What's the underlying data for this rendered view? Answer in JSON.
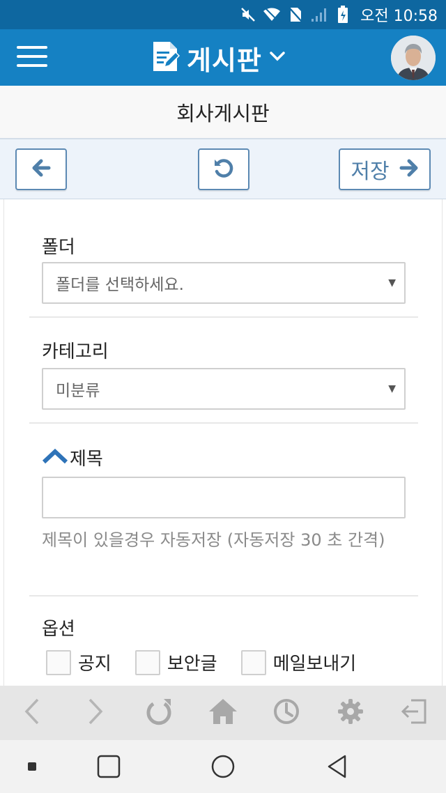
{
  "status_bar": {
    "carrier_time": "오전 10:58",
    "icons": [
      "mute-icon",
      "wifi-icon",
      "no-sim-icon",
      "signal-icon",
      "battery-icon"
    ]
  },
  "app_bar": {
    "title": "게시판",
    "icons": {
      "menu": "hamburger-menu-icon",
      "board": "board-document-icon",
      "dropdown": "chevron-down-icon",
      "avatar": "user-avatar"
    }
  },
  "sub_header": {
    "board_name": "회사게시판"
  },
  "toolbar": {
    "back_icon": "arrow-left-icon",
    "refresh_icon": "refresh-icon",
    "save_label": "저장",
    "save_icon": "arrow-right-icon"
  },
  "form": {
    "folder": {
      "label": "폴더",
      "selected": "폴더를 선택하세요."
    },
    "category": {
      "label": "카테고리",
      "selected": "미분류"
    },
    "subject": {
      "label": "제목",
      "value": "",
      "hint": "제목이 있을경우 자동저장 (자동저장 30 초 간격)"
    },
    "options": {
      "label": "옵션",
      "items": [
        {
          "label": "공지",
          "checked": false
        },
        {
          "label": "보안글",
          "checked": false
        },
        {
          "label": "메일보내기",
          "checked": false
        }
      ]
    }
  },
  "browser_bar": {
    "icons": [
      "back-icon",
      "forward-icon",
      "reload-icon",
      "home-icon",
      "history-icon",
      "settings-icon",
      "logout-icon"
    ]
  },
  "nav_bar": {
    "icons": [
      "recent-dot-icon",
      "overview-square-icon",
      "home-circle-icon",
      "back-triangle-icon"
    ]
  },
  "colors": {
    "status_bar": "#0e67a0",
    "app_bar": "#1581c3",
    "toolbar_bg": "#edf3fa",
    "button_border": "#5c89b3",
    "accent_chevron": "#2e73b8"
  }
}
